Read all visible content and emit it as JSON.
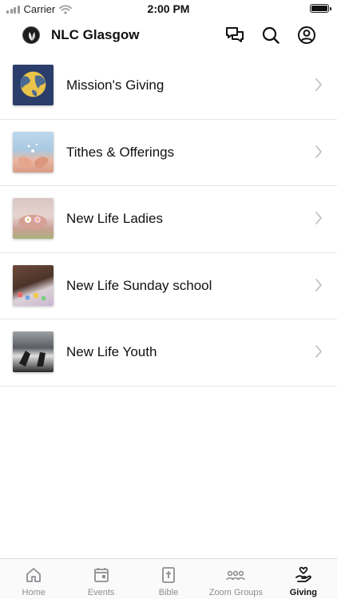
{
  "status_bar": {
    "carrier": "Carrier",
    "time": "2:00 PM"
  },
  "header": {
    "title": "NLC Glasgow",
    "logo_icon": "church-leaf-logo",
    "actions": [
      "chat-icon",
      "search-icon",
      "account-icon"
    ]
  },
  "giving_items": [
    {
      "label": "Mission's Giving"
    },
    {
      "label": "Tithes & Offerings"
    },
    {
      "label": "New Life Ladies"
    },
    {
      "label": "New Life Sunday school"
    },
    {
      "label": "New Life Youth"
    }
  ],
  "tabs": [
    {
      "label": "Home",
      "icon": "home-icon",
      "active": false
    },
    {
      "label": "Events",
      "icon": "calendar-icon",
      "active": false
    },
    {
      "label": "Bible",
      "icon": "bible-icon",
      "active": false
    },
    {
      "label": "Zoom Groups",
      "icon": "group-icon",
      "active": false
    },
    {
      "label": "Giving",
      "icon": "giving-hand-heart-icon",
      "active": true
    }
  ],
  "colors": {
    "active_tab": "#111111",
    "inactive_tab": "#8e8e93",
    "divider": "#e4e4e4"
  }
}
